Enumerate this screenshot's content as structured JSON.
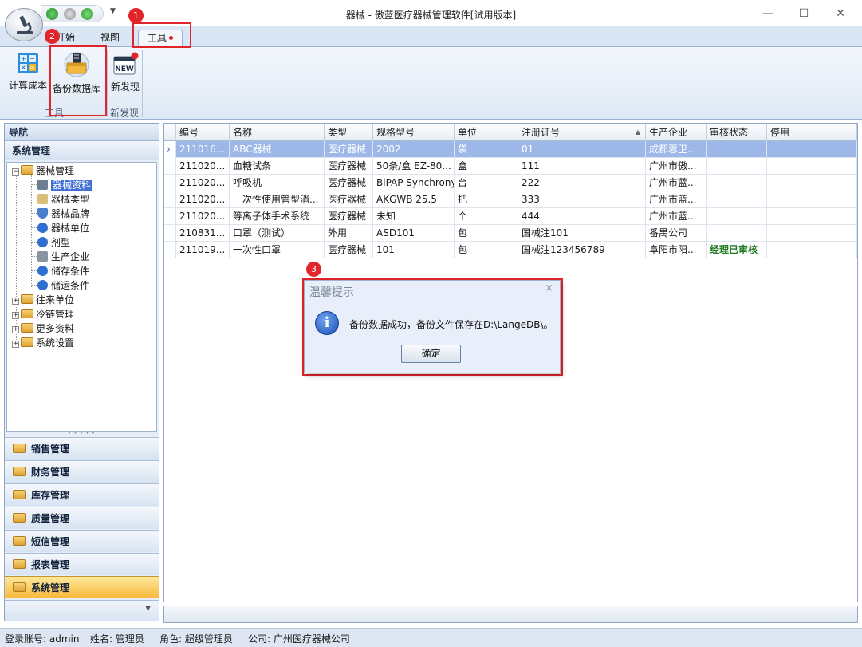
{
  "window": {
    "title": "器械 - 傲蓝医疗器械管理软件[试用版本]",
    "minimize": "—",
    "maximize": "☐",
    "close": "✕"
  },
  "ribbon": {
    "tabs": [
      {
        "label": "开始"
      },
      {
        "label": "视图"
      },
      {
        "label": "工具"
      }
    ],
    "buttons": {
      "cost": "计算成本",
      "backup": "备份数据库",
      "discover": "新发现"
    },
    "groups": {
      "tools": "工具",
      "discover": "新发现"
    }
  },
  "annotations": [
    "1",
    "2",
    "3"
  ],
  "nav": {
    "header": "导航",
    "section": "系统管理",
    "tree": [
      "器械管理",
      "器械资料",
      "器械类型",
      "器械品牌",
      "器械单位",
      "剂型",
      "生产企业",
      "储存条件",
      "储运条件",
      "往来单位",
      "冷链管理",
      "更多资料",
      "系统设置"
    ],
    "bars": [
      "销售管理",
      "财务管理",
      "库存管理",
      "质量管理",
      "短信管理",
      "报表管理",
      "系统管理"
    ]
  },
  "grid": {
    "columns": [
      "编号",
      "名称",
      "类型",
      "规格型号",
      "单位",
      "注册证号",
      "生产企业",
      "审核状态",
      "停用"
    ],
    "rows": [
      [
        "211016...",
        "ABC器械",
        "医疗器械",
        "2002",
        "袋",
        "01",
        "成都蓉卫...",
        "",
        ""
      ],
      [
        "211020...",
        "血糖试条",
        "医疗器械",
        "50条/盒 EZ-80...",
        "盒",
        "111",
        "广州市傲...",
        "",
        ""
      ],
      [
        "211020...",
        "呼吸机",
        "医疗器械",
        "BiPAP Synchrony",
        "台",
        "222",
        "广州市蓝...",
        "",
        ""
      ],
      [
        "211020...",
        "一次性使用管型消...",
        "医疗器械",
        "AKGWB 25.5",
        "把",
        "333",
        "广州市蓝...",
        "",
        ""
      ],
      [
        "211020...",
        "等离子体手术系统",
        "医疗器械",
        "未知",
        "个",
        "444",
        "广州市蓝...",
        "",
        ""
      ],
      [
        "210831...",
        "口罩（测试）",
        "外用",
        "ASD101",
        "包",
        "国械注101",
        "番禺公司",
        "",
        ""
      ],
      [
        "211019...",
        "一次性口罩",
        "医疗器械",
        "101",
        "包",
        "国械注123456789",
        "阜阳市阳...",
        "经理已审核",
        ""
      ]
    ]
  },
  "dialog": {
    "title": "温馨提示",
    "close": "×",
    "message": "备份数据成功，备份文件保存在D:\\LangeDB\\。",
    "ok": "确定"
  },
  "status": {
    "account": "登录账号: admin",
    "name": "姓名: 管理员",
    "role": "角色: 超级管理员",
    "company": "公司: 广州医疗器械公司"
  },
  "colors": {
    "accent": "#3f6fd6",
    "highlight": "#e0262b",
    "selected_row": "#9cb7e8",
    "active_nav": "#f8b739"
  }
}
